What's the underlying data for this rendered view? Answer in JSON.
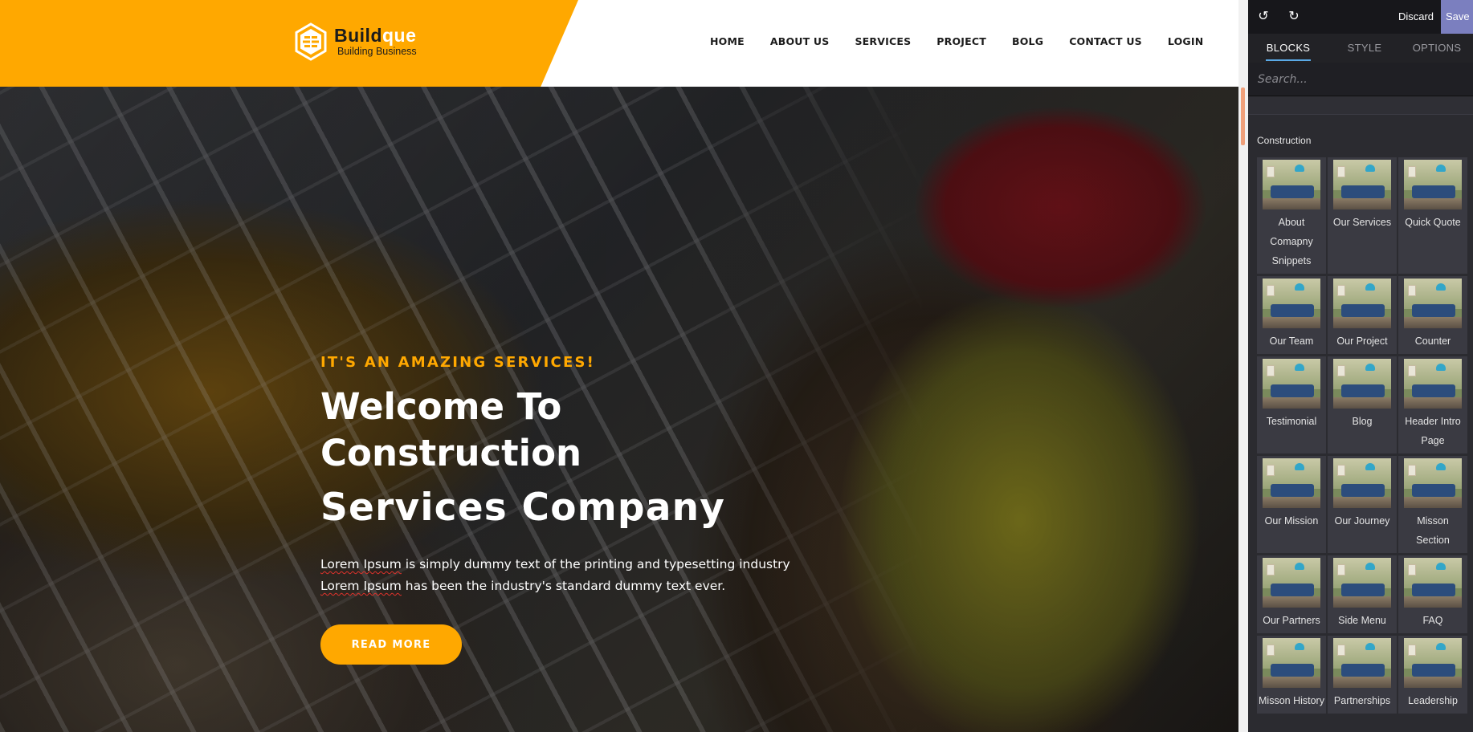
{
  "site": {
    "logo": {
      "name_prefix": "Build",
      "name_accent": "que",
      "tagline": "Building Business"
    },
    "nav": [
      "HOME",
      "ABOUT US",
      "SERVICES",
      "PROJECT",
      "BOLG",
      "CONTACT US",
      "LOGIN"
    ],
    "hero": {
      "kicker": "IT'S AN AMAZING SERVICES!",
      "title_line1": "Welcome To",
      "title_line2": "Construction",
      "title_line3": "Services Company",
      "desc_line1_underlined": "Lorem Ipsum",
      "desc_line1_rest": " is simply dummy text of the printing and typesetting industry",
      "desc_line2_underlined": "Lorem Ipsum",
      "desc_line2_rest": " has been the industry's standard dummy text ever.",
      "button": "READ MORE"
    }
  },
  "panel": {
    "topbar": {
      "discard": "Discard",
      "save": "Save"
    },
    "tabs": [
      "BLOCKS",
      "STYLE",
      "OPTIONS"
    ],
    "search_placeholder": "Search...",
    "category": "Construction",
    "blocks": [
      "About Comapny Snippets",
      "Our Services",
      "Quick Quote",
      "Our Team",
      "Our Project",
      "Counter",
      "Testimonial",
      "Blog",
      "Header Intro Page",
      "Our Mission",
      "Our Journey",
      "Misson Section",
      "Our Partners",
      "Side Menu",
      "FAQ",
      "Misson History",
      "Partnerships",
      "Leadership"
    ]
  },
  "colors": {
    "brand_yellow": "#ffa800",
    "panel_bg": "#2b2b30",
    "save_accent": "#7b7fbf",
    "tab_underline": "#5aa9e6"
  }
}
